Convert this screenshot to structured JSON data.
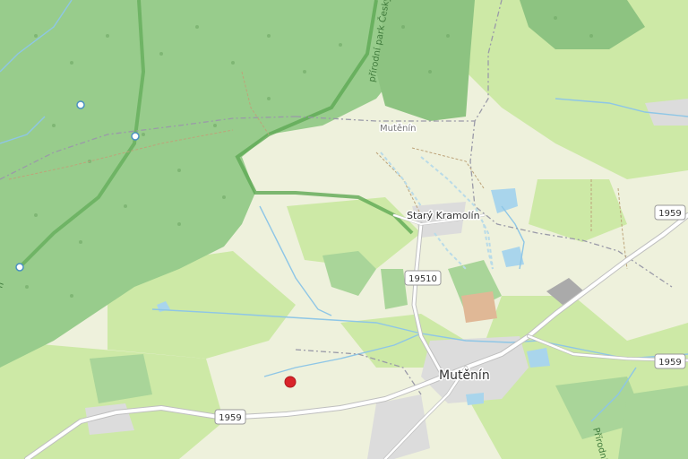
{
  "labels": {
    "mutenin_big": "Mutěnín",
    "mutenin_small": "Mutěnín",
    "stary_kramolin": "Starý Kramolín",
    "park_upper": "přírodní park Český",
    "park_lower": "Přírodní",
    "left_edge_fragment": "n"
  },
  "road_shields": {
    "r1959_bottom": "1959",
    "r1959_right_top": "1959",
    "r1959_right_mid": "1959",
    "r19510": "19510"
  },
  "marker": {
    "color": "#d9242a"
  },
  "colors": {
    "forest": "#98cc8c",
    "dark_forest": "#7fb874",
    "grass": "#cde9a6",
    "farmland": "#eef1dc",
    "water": "#a9d5ec",
    "road": "#ffffff",
    "road_casing": "#bfbfbf",
    "boundary": "#9a9aa8",
    "residential": "#dcdcdc",
    "park_border": "#5ea954"
  }
}
